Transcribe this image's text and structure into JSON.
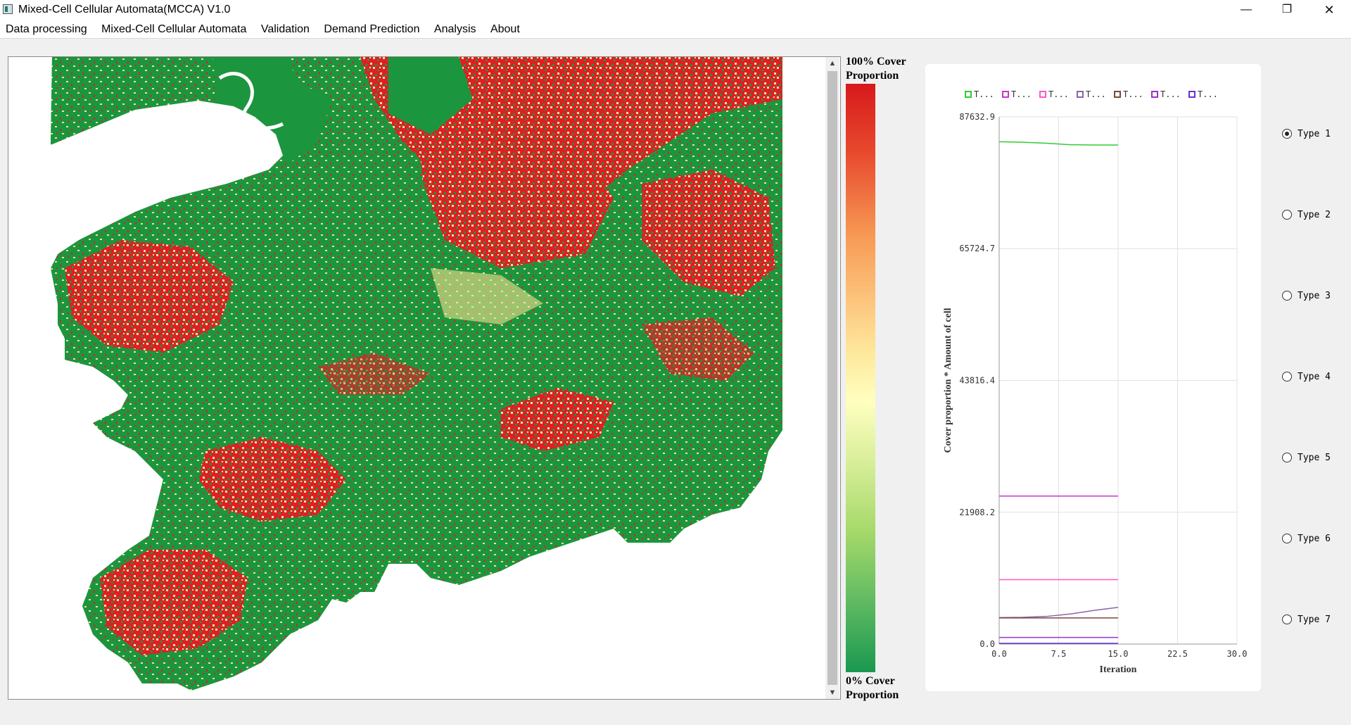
{
  "window": {
    "title": "Mixed-Cell Cellular Automata(MCCA) V1.0",
    "minimize_icon": "minimize-icon",
    "maximize_icon": "restore-icon",
    "close_icon": "close-icon"
  },
  "menu": [
    "Data processing",
    "Mixed-Cell Cellular Automata",
    "Validation",
    "Demand Prediction",
    "Analysis",
    "About"
  ],
  "legend": {
    "top_label": "100% Cover Proportion",
    "bottom_label": "0% Cover Proportion",
    "colors": [
      "#d7191c",
      "#fdae61",
      "#ffffbf",
      "#a6d96a",
      "#1a9850"
    ]
  },
  "map": {
    "colors": {
      "high": "#de1f26",
      "mid": "#f3e28f",
      "low": "#1c953f",
      "nodata": "#ffffff"
    }
  },
  "chart_data": {
    "type": "line",
    "xlabel": "Iteration",
    "ylabel": "Cover proportion * Amount of cell",
    "x_ticks": [
      "0.0",
      "7.5",
      "15.0",
      "22.5",
      "30.0"
    ],
    "y_ticks": [
      "0.0",
      "21908.2",
      "43816.4",
      "65724.7",
      "87632.9"
    ],
    "xlim": [
      0,
      30
    ],
    "ylim": [
      0,
      87632.9
    ],
    "legend": [
      "T...",
      "T...",
      "T...",
      "T...",
      "T...",
      "T...",
      "T..."
    ],
    "series": [
      {
        "color": "#33cc33",
        "x": [
          0,
          3,
          6,
          9,
          12,
          15
        ],
        "y": [
          83500,
          83400,
          83250,
          83000,
          82950,
          82950
        ]
      },
      {
        "color": "#cc33cc",
        "x": [
          0,
          15
        ],
        "y": [
          24600,
          24600
        ]
      },
      {
        "color": "#ff55cc",
        "x": [
          0,
          15
        ],
        "y": [
          10700,
          10700
        ]
      },
      {
        "color": "#8866aa",
        "x": [
          0,
          3,
          6,
          9,
          12,
          15
        ],
        "y": [
          4400,
          4450,
          4600,
          5000,
          5600,
          6100
        ]
      },
      {
        "color": "#7a4a3a",
        "x": [
          0,
          15
        ],
        "y": [
          4350,
          4350
        ]
      },
      {
        "color": "#9933cc",
        "x": [
          0,
          15
        ],
        "y": [
          1100,
          1100
        ]
      },
      {
        "color": "#6633cc",
        "x": [
          0,
          15
        ],
        "y": [
          120,
          120
        ]
      }
    ]
  },
  "types": [
    {
      "label": "Type 1",
      "checked": true
    },
    {
      "label": "Type 2",
      "checked": false
    },
    {
      "label": "Type 3",
      "checked": false
    },
    {
      "label": "Type 4",
      "checked": false
    },
    {
      "label": "Type 5",
      "checked": false
    },
    {
      "label": "Type 6",
      "checked": false
    },
    {
      "label": "Type 7",
      "checked": false
    }
  ]
}
